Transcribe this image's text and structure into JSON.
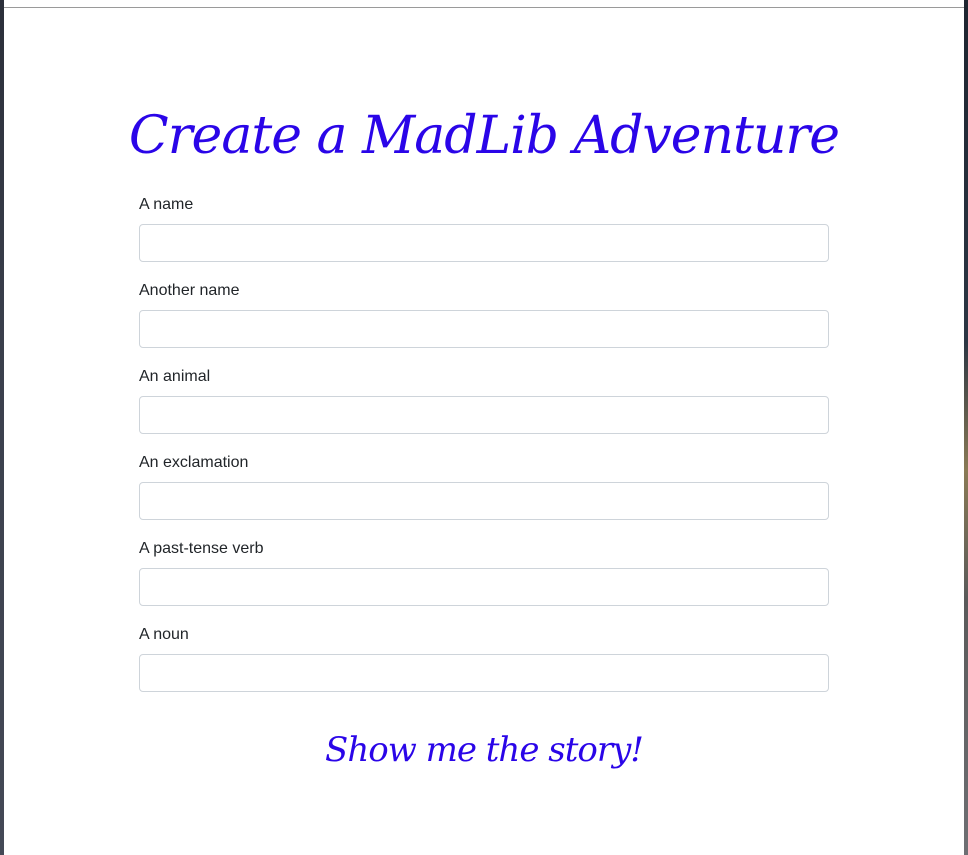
{
  "page": {
    "title": "Create a MadLib Adventure"
  },
  "form": {
    "fields": [
      {
        "label": "A name",
        "value": "",
        "placeholder": ""
      },
      {
        "label": "Another name",
        "value": "",
        "placeholder": ""
      },
      {
        "label": "An animal",
        "value": "",
        "placeholder": ""
      },
      {
        "label": "An exclamation",
        "value": "",
        "placeholder": ""
      },
      {
        "label": "A past-tense verb",
        "value": "",
        "placeholder": ""
      },
      {
        "label": "A noun",
        "value": "",
        "placeholder": ""
      }
    ],
    "submit_label": "Show me the story!"
  },
  "colors": {
    "accent": "#2a05e8",
    "text": "#212529",
    "input_border": "#ced4da"
  }
}
